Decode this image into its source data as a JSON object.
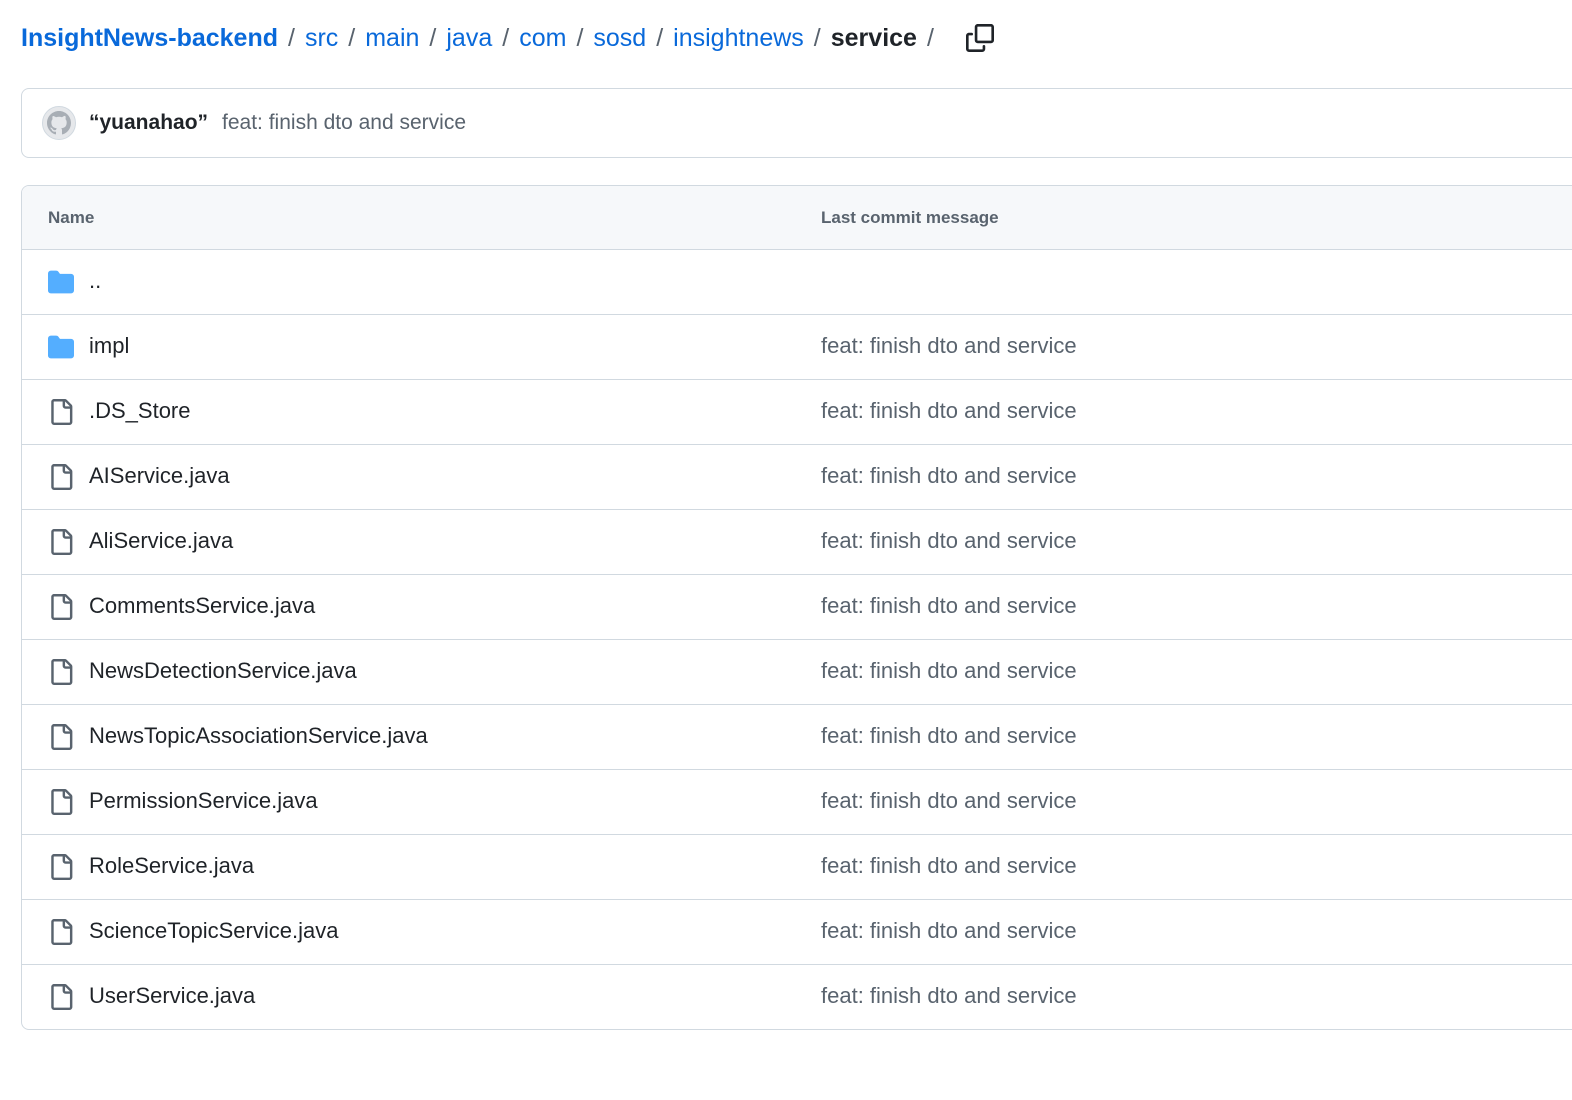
{
  "breadcrumb": {
    "repo": "InsightNews-backend",
    "segments": [
      "src",
      "main",
      "java",
      "com",
      "sosd",
      "insightnews"
    ],
    "current": "service",
    "separator": "/",
    "trailing": "/"
  },
  "latest_commit": {
    "author": "“yuanahao”",
    "message": "feat: finish dto and service"
  },
  "table": {
    "header_name": "Name",
    "header_message": "Last commit message",
    "rows": [
      {
        "name": "..",
        "type": "folder",
        "message": ""
      },
      {
        "name": "impl",
        "type": "folder",
        "message": "feat: finish dto and service"
      },
      {
        "name": ".DS_Store",
        "type": "file",
        "message": "feat: finish dto and service"
      },
      {
        "name": "AIService.java",
        "type": "file",
        "message": "feat: finish dto and service"
      },
      {
        "name": "AliService.java",
        "type": "file",
        "message": "feat: finish dto and service"
      },
      {
        "name": "CommentsService.java",
        "type": "file",
        "message": "feat: finish dto and service"
      },
      {
        "name": "NewsDetectionService.java",
        "type": "file",
        "message": "feat: finish dto and service"
      },
      {
        "name": "NewsTopicAssociationService.java",
        "type": "file",
        "message": "feat: finish dto and service"
      },
      {
        "name": "PermissionService.java",
        "type": "file",
        "message": "feat: finish dto and service"
      },
      {
        "name": "RoleService.java",
        "type": "file",
        "message": "feat: finish dto and service"
      },
      {
        "name": "ScienceTopicService.java",
        "type": "file",
        "message": "feat: finish dto and service"
      },
      {
        "name": "UserService.java",
        "type": "file",
        "message": "feat: finish dto and service"
      }
    ]
  },
  "icons": {
    "folder": "folder-icon",
    "file": "file-icon",
    "copy": "copy-icon",
    "avatar": "github-avatar-icon"
  },
  "colors": {
    "link": "#0969da",
    "folder": "#54aeff",
    "muted": "#59636e",
    "border": "#d1d9e0"
  }
}
